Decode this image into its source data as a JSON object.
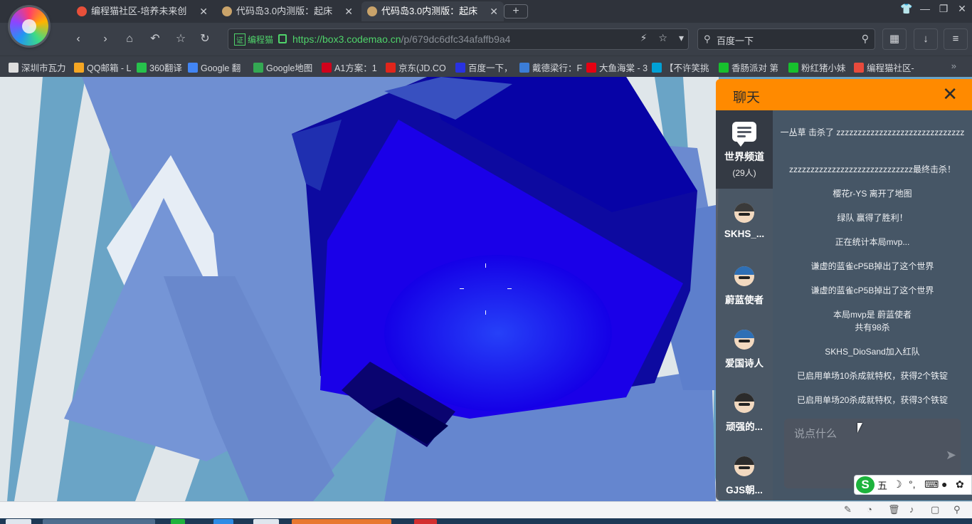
{
  "browser": {
    "tabs": [
      {
        "title": "编程猫社区-培养未来创",
        "icon": "codemao-tab-icon",
        "active": false
      },
      {
        "title": "代码岛3.0内测版：起床",
        "icon": "box3-tab-icon",
        "active": false
      },
      {
        "title": "代码岛3.0内测版：起床",
        "icon": "box3-tab-icon",
        "active": true
      }
    ],
    "cert_label": "编程猫",
    "url_host": "https://box3.codemao.cn",
    "url_path": "/p/679dc6dfc34afaffb9a4",
    "search_engine_label": "百度一下",
    "bookmarks": [
      {
        "label": "深圳市瓦力",
        "color": "#dddddd"
      },
      {
        "label": "QQ邮箱 - L",
        "color": "#f5a623"
      },
      {
        "label": "360翻译",
        "color": "#27c24c"
      },
      {
        "label": "Google 翻",
        "color": "#4285f4"
      },
      {
        "label": "Google地图",
        "color": "#34a853"
      },
      {
        "label": "A1方案：1",
        "color": "#d0021b"
      },
      {
        "label": "京东(JD.CO",
        "color": "#e1251b"
      },
      {
        "label": "百度一下，",
        "color": "#2932e1"
      },
      {
        "label": "戴德梁行：F",
        "color": "#3b7dd8"
      },
      {
        "label": "大鱼海棠 - 3",
        "color": "#e60012"
      },
      {
        "label": "【不许笑挑",
        "color": "#00a1d6"
      },
      {
        "label": "香肠派对 第",
        "color": "#17c12d"
      },
      {
        "label": "粉红猪小妹",
        "color": "#17c12d"
      },
      {
        "label": "编程猫社区-",
        "color": "#e84a3c"
      }
    ]
  },
  "chat": {
    "title": "聊天",
    "world_channel": {
      "name": "世界频道",
      "count": "(29人)"
    },
    "users": [
      {
        "name": "SKHS_...",
        "hair": "#3a3a3a"
      },
      {
        "name": "蔚蓝使者",
        "hair": "#2e6fb5"
      },
      {
        "name": "爱国诗人",
        "hair": "#2e6fb5"
      },
      {
        "name": "顽强的...",
        "hair": "#2b2b2b"
      },
      {
        "name": "GJS朝...",
        "hair": "#2b2b2b"
      }
    ],
    "messages": [
      "一丛草 击杀了 zzzzzzzzzzzzzzzzzzzzzzzzzzzzzz",
      "zzzzzzzzzzzzzzzzzzzzzzzzzzzzz最终击杀！",
      "樱花r-YS 离开了地图",
      "绿队 赢得了胜利！",
      "正在统计本局mvp...",
      "谦虚的蓝雀cP5B掉出了这个世界",
      "谦虚的蓝雀cP5B掉出了这个世界",
      "本局mvp是 蔚蓝使者\n共有98杀",
      "SKHS_DioSand加入红队",
      "已启用单场10杀成就特权，获得2个铁锭",
      "已启用单场20杀成就特权，获得3个铁锭"
    ],
    "input_placeholder": "说点什么"
  },
  "ime": {
    "label": "五"
  },
  "colors": {
    "accent": "#ff8a00",
    "url_green": "#4fd36a"
  }
}
